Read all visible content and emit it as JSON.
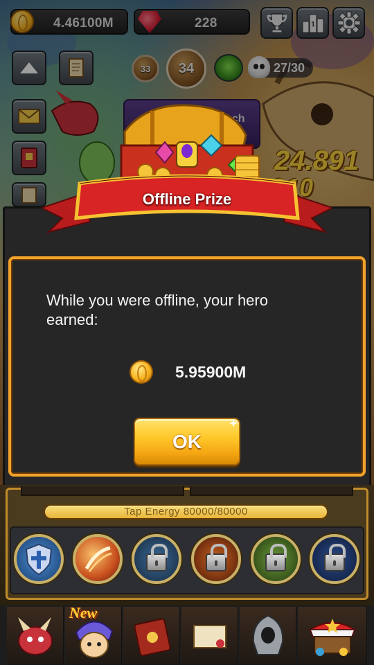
{
  "top_bar": {
    "gold_amount": "4.46100M",
    "gem_amount": "228",
    "icons": [
      "gold-coin-icon",
      "red-gem-icon",
      "trophy-icon",
      "leaderboard-icon",
      "gear-icon"
    ]
  },
  "side_buttons": [
    "collapse-arrow-icon",
    "quest-scroll-icon",
    "mail-icon",
    "spellbook-icon",
    "map-scroll-icon"
  ],
  "stage": {
    "previous_level": "33",
    "current_level": "34",
    "kill_progress": "27/30"
  },
  "scene": {
    "launch_text": "launch",
    "damage_number": "24.891",
    "damage_fragment": "910"
  },
  "dialog": {
    "banner_title": "Offline Prize",
    "message": "While you were offline, your hero earned:",
    "reward_amount": "5.95900M",
    "ok_label": "OK"
  },
  "energy": {
    "label": "Tap Energy  80000/80000"
  },
  "skills": [
    {
      "name": "shield-skill",
      "locked": false
    },
    {
      "name": "slash-skill",
      "locked": false
    },
    {
      "name": "skill-3",
      "locked": true
    },
    {
      "name": "skill-4",
      "locked": true
    },
    {
      "name": "skill-5",
      "locked": true
    },
    {
      "name": "skill-6",
      "locked": true
    }
  ],
  "bottom_nav": {
    "new_badge": "New",
    "tabs": [
      "hero-dragon-tab",
      "heroes-tab",
      "spellbook-tab",
      "artifacts-tab",
      "guardian-tab",
      "shop-tab"
    ]
  },
  "colors": {
    "dialog_border": "#f2a22a",
    "ok_button": "#ffc92b",
    "banner_red": "#d82424",
    "banner_gold": "#f5c232"
  }
}
